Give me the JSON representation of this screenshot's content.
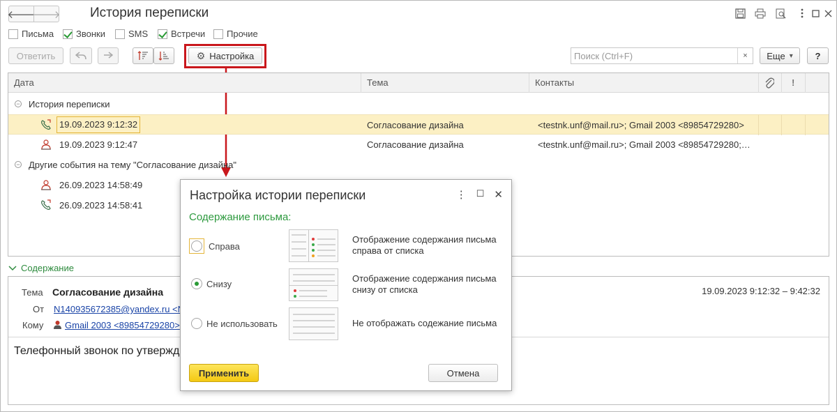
{
  "window": {
    "title": "История переписки",
    "back_glyph": "🡐",
    "fwd_glyph": "🡒",
    "icons": [
      "save-icon",
      "print-icon",
      "preview-icon",
      "more-icon",
      "maximize-icon",
      "close-icon"
    ]
  },
  "filters": [
    {
      "label": "Письма",
      "checked": false
    },
    {
      "label": "Звонки",
      "checked": true
    },
    {
      "label": "SMS",
      "checked": false
    },
    {
      "label": "Встречи",
      "checked": true
    },
    {
      "label": "Прочие",
      "checked": false
    }
  ],
  "toolbar": {
    "reply_label": "Ответить",
    "settings_label": "Настройка",
    "search_placeholder": "Поиск (Ctrl+F)",
    "clear_glyph": "×",
    "more_label": "Еще",
    "more_caret": "▾",
    "help_label": "?",
    "gear_glyph": "⚙"
  },
  "table": {
    "columns": [
      "Дата",
      "Тема",
      "Контакты"
    ],
    "groups": [
      {
        "label": "История переписки"
      },
      {
        "label": "Другие события на тему \"Согласование дизайна\""
      }
    ],
    "rows": [
      {
        "date": "19.09.2023 9:12:32",
        "topic": "Согласование дизайна",
        "contacts": "<testnk.unf@mail.ru>; Gmail 2003 <89854729280>",
        "type": "call"
      },
      {
        "date": "19.09.2023 9:12:47",
        "topic": "Согласование дизайна",
        "contacts": "<testnk.unf@mail.ru>; Gmail 2003 <89854729280;…",
        "type": "meeting"
      },
      {
        "date": "26.09.2023 14:58:49",
        "topic": "",
        "contacts": "",
        "type": "meeting"
      },
      {
        "date": "26.09.2023 14:58:41",
        "topic": "",
        "contacts": "",
        "type": "call"
      }
    ]
  },
  "content": {
    "section_label": "Содержание",
    "topic_label": "Тема",
    "topic_value": "Согласование дизайна",
    "from_label": "От",
    "from_value": "N140935672385@yandex.ru <N1",
    "to_label": "Кому",
    "to_value": "Gmail 2003 <89854729280>",
    "period": "19.09.2023 9:12:32 – 9:42:32",
    "body": "Телефонный звонок по утвержд"
  },
  "dialog": {
    "title": "Настройка истории переписки",
    "subtitle": "Содержание письма:",
    "menu_glyph": "⋮",
    "max_glyph": "☐",
    "close_glyph": "✕",
    "options": [
      {
        "label": "Справа",
        "desc1": "Отображение содержания письма",
        "desc2": "справа от списка",
        "selected": false
      },
      {
        "label": "Снизу",
        "desc1": "Отображение содержания письма",
        "desc2": "снизу от списка",
        "selected": true
      },
      {
        "label": "Не использовать",
        "desc1": "Не отображать содежание письма",
        "desc2": "",
        "selected": false
      }
    ],
    "apply_label": "Применить",
    "cancel_label": "Отмена"
  },
  "colors": {
    "accent": "#2e9a3f",
    "highlight": "#c9171c",
    "selected_row": "#fcf0c4",
    "link": "#1a44a7"
  }
}
